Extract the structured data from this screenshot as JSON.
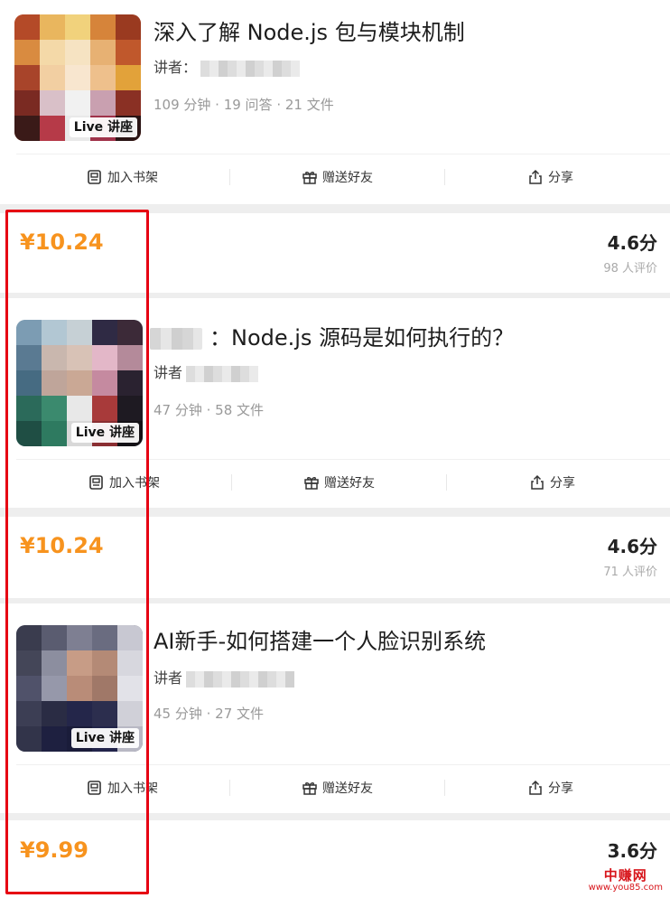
{
  "courses": [
    {
      "title": "深入了解 Node.js 包与模块机制",
      "lecturer_label": "讲者：",
      "meta": "109 分钟 · 19 问答 · 21 文件",
      "badge": "Live 讲座",
      "actions": {
        "shelf": "加入书架",
        "gift": "赠送好友",
        "share": "分享"
      },
      "price": "¥10.24",
      "score": "4.6分",
      "review_count": "98 人评价"
    },
    {
      "title": "：Node.js 源码是如何执行的？",
      "lecturer_label": "讲者",
      "meta": "47 分钟 · 58 文件",
      "badge": "Live 讲座",
      "actions": {
        "shelf": "加入书架",
        "gift": "赠送好友",
        "share": "分享"
      },
      "price": "¥10.24",
      "score": "4.6分",
      "review_count": "71 人评价"
    },
    {
      "title": "AI新手-如何搭建一个人脸识别系统",
      "lecturer_label": "讲者",
      "meta": "45 分钟 · 27 文件",
      "badge": "Live 讲座",
      "actions": {
        "shelf": "加入书架",
        "gift": "赠送好友",
        "share": "分享"
      },
      "price": "¥9.99",
      "score": "3.6分"
    }
  ],
  "watermark": {
    "brand": "中赚网",
    "url": "www.you85.com"
  },
  "colors": {
    "price": "#f7931e",
    "highlight": "#e60012",
    "watermark": "#d7141a"
  }
}
